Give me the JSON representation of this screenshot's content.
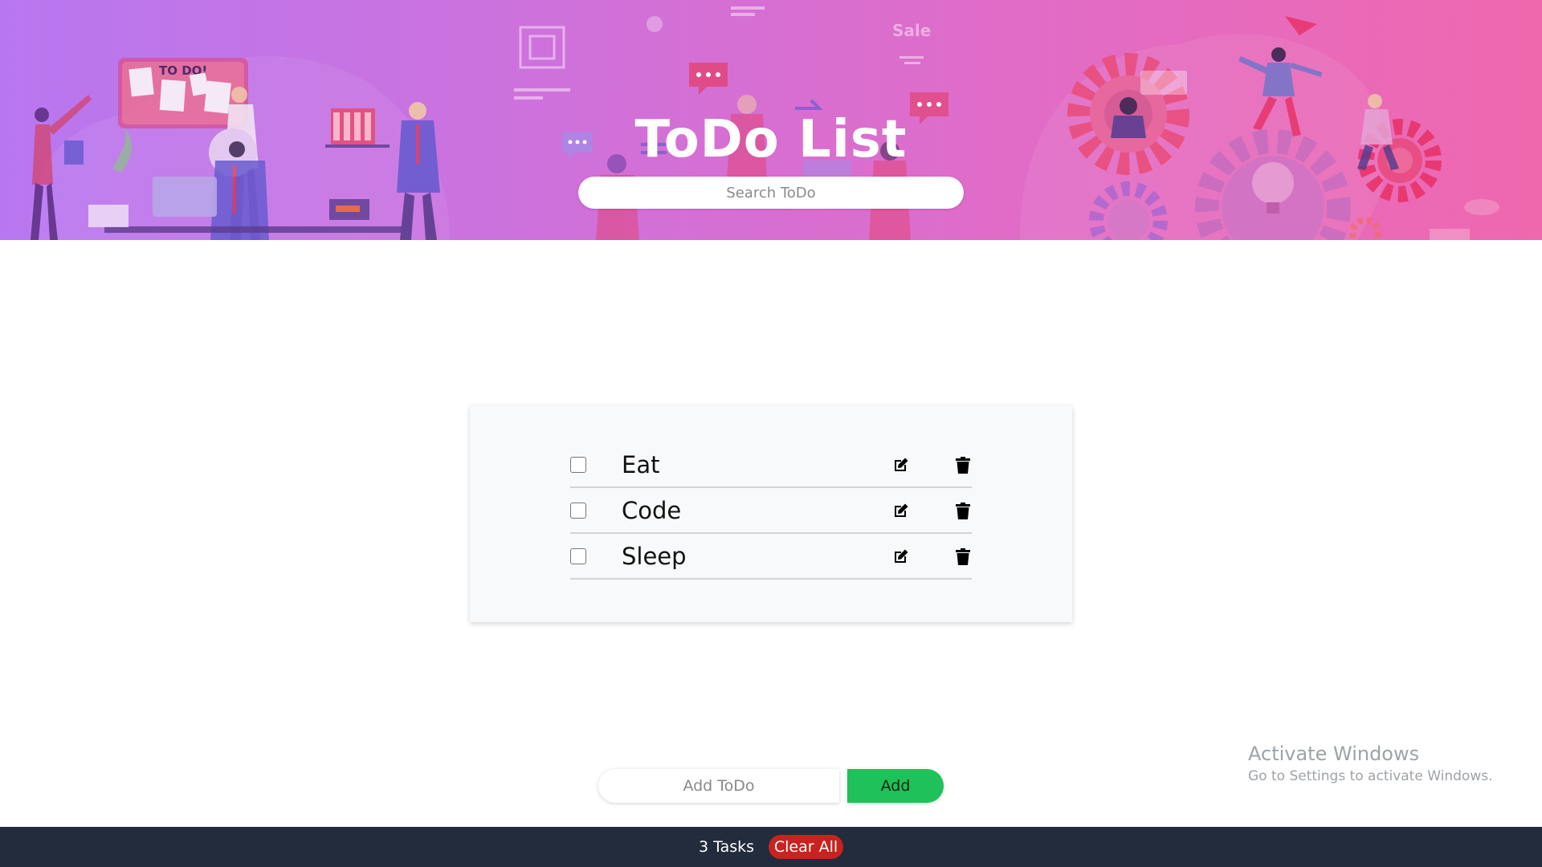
{
  "header": {
    "title": "ToDo List",
    "search_placeholder": "Search ToDo",
    "illustration": {
      "board_label": "TO DO!",
      "sale_label": "Sale"
    }
  },
  "todos": [
    {
      "text": "Eat",
      "checked": false
    },
    {
      "text": "Code",
      "checked": false
    },
    {
      "text": "Sleep",
      "checked": false
    }
  ],
  "add_form": {
    "placeholder": "Add ToDo",
    "button_label": "Add"
  },
  "footer": {
    "task_count": "3 Tasks",
    "clear_label": "Clear All"
  },
  "watermark": {
    "title": "Activate Windows",
    "subtitle": "Go to Settings to activate Windows."
  },
  "icons": {
    "edit": "edit-icon",
    "delete": "trash-icon"
  },
  "colors": {
    "header_start": "#b877f0",
    "header_end": "#ef68ae",
    "add_button": "#1fc15a",
    "clear_button": "#c9231f",
    "footer": "#222c3c"
  }
}
